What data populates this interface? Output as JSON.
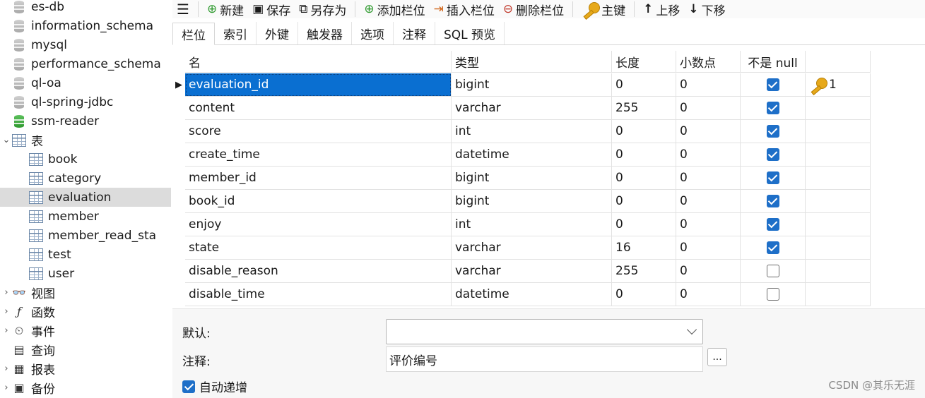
{
  "sidebar": {
    "databases": [
      {
        "name": "es-db"
      },
      {
        "name": "information_schema"
      },
      {
        "name": "mysql"
      },
      {
        "name": "performance_schema"
      },
      {
        "name": "ql-oa"
      },
      {
        "name": "ql-spring-jdbc"
      },
      {
        "name": "ssm-reader"
      }
    ],
    "tables_group": "表",
    "tables": [
      "book",
      "category",
      "evaluation",
      "member",
      "member_read_sta",
      "test",
      "user"
    ],
    "selected_table": "evaluation",
    "groups": [
      {
        "label": "视图",
        "icon": "glasses-icon"
      },
      {
        "label": "函数",
        "icon": "function-icon"
      },
      {
        "label": "事件",
        "icon": "event-clock-icon"
      },
      {
        "label": "查询",
        "icon": "query-icon"
      },
      {
        "label": "报表",
        "icon": "report-icon"
      },
      {
        "label": "备份",
        "icon": "backup-icon"
      }
    ]
  },
  "toolbar": {
    "menu_glyph": "☰",
    "new": "新建",
    "save": "保存",
    "save_as": "另存为",
    "add_field": "添加栏位",
    "insert_field": "插入栏位",
    "delete_field": "删除栏位",
    "primary_key": "主键",
    "move_up": "上移",
    "move_down": "下移"
  },
  "tabs": [
    "栏位",
    "索引",
    "外键",
    "触发器",
    "选项",
    "注释",
    "SQL 预览"
  ],
  "active_tab": "栏位",
  "grid": {
    "headers": {
      "name": "名",
      "type": "类型",
      "length": "长度",
      "decimal": "小数点",
      "not_null": "不是 null",
      "key": ""
    },
    "rows": [
      {
        "name": "evaluation_id",
        "type": "bigint",
        "length": "0",
        "decimal": "0",
        "not_null": true,
        "key": "1"
      },
      {
        "name": "content",
        "type": "varchar",
        "length": "255",
        "decimal": "0",
        "not_null": true,
        "key": ""
      },
      {
        "name": "score",
        "type": "int",
        "length": "0",
        "decimal": "0",
        "not_null": true,
        "key": ""
      },
      {
        "name": "create_time",
        "type": "datetime",
        "length": "0",
        "decimal": "0",
        "not_null": true,
        "key": ""
      },
      {
        "name": "member_id",
        "type": "bigint",
        "length": "0",
        "decimal": "0",
        "not_null": true,
        "key": ""
      },
      {
        "name": "book_id",
        "type": "bigint",
        "length": "0",
        "decimal": "0",
        "not_null": true,
        "key": ""
      },
      {
        "name": "enjoy",
        "type": "int",
        "length": "0",
        "decimal": "0",
        "not_null": true,
        "key": ""
      },
      {
        "name": "state",
        "type": "varchar",
        "length": "16",
        "decimal": "0",
        "not_null": true,
        "key": ""
      },
      {
        "name": "disable_reason",
        "type": "varchar",
        "length": "255",
        "decimal": "0",
        "not_null": false,
        "key": ""
      },
      {
        "name": "disable_time",
        "type": "datetime",
        "length": "0",
        "decimal": "0",
        "not_null": false,
        "key": ""
      }
    ]
  },
  "properties": {
    "default_label": "默认:",
    "default_value": "",
    "comment_label": "注释:",
    "comment_value": "评价编号",
    "more_button": "...",
    "auto_increment_label": "自动递增",
    "auto_increment": true
  },
  "watermark": "CSDN @其乐无涯",
  "colors": {
    "accent": "#1e6fc8",
    "selection": "#0a6fd1",
    "key": "#e7a91a"
  }
}
